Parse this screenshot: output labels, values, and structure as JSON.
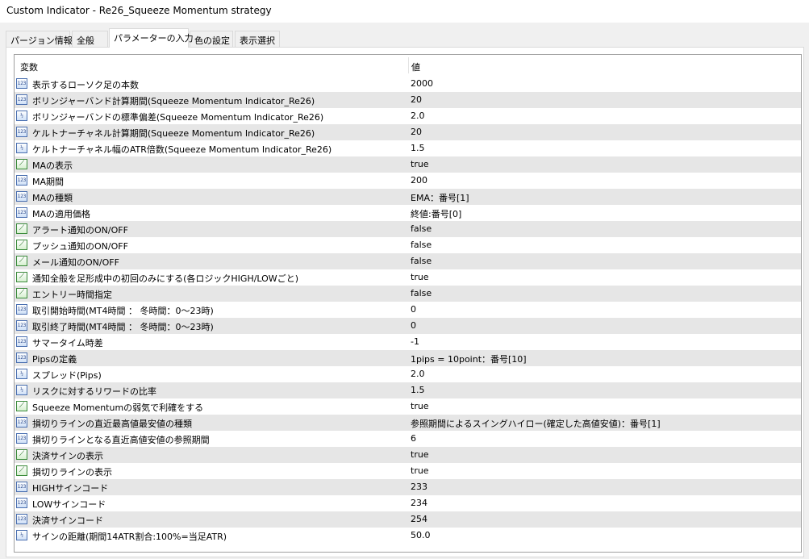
{
  "window": {
    "title": "Custom Indicator - Re26_Squeeze Momentum strategy"
  },
  "tabs": [
    {
      "label": "パージョン情報",
      "active": false
    },
    {
      "label": "全般",
      "active": false
    },
    {
      "label": "パラメーターの入力",
      "active": true
    },
    {
      "label": "色の設定",
      "active": false
    },
    {
      "label": "表示選択",
      "active": false
    }
  ],
  "table": {
    "headers": {
      "variable": "変数",
      "value": "値"
    },
    "rows": [
      {
        "icon": "int-icon",
        "icon_text": "123",
        "name": "表示するローソク足の本数",
        "value": "2000"
      },
      {
        "icon": "int-icon",
        "icon_text": "123",
        "name": "ボリンジャーバンド計算期間(Squeeze Momentum Indicator_Re26)",
        "value": "20"
      },
      {
        "icon": "double-icon",
        "icon_text": "½",
        "name": "ボリンジャーバンドの標準偏差(Squeeze Momentum Indicator_Re26)",
        "value": "2.0"
      },
      {
        "icon": "int-icon",
        "icon_text": "123",
        "name": "ケルトナーチャネル計算期間(Squeeze Momentum Indicator_Re26)",
        "value": "20"
      },
      {
        "icon": "double-icon",
        "icon_text": "½",
        "name": "ケルトナーチャネル幅のATR倍数(Squeeze Momentum Indicator_Re26)",
        "value": "1.5"
      },
      {
        "icon": "bool-icon",
        "icon_text": "⟋",
        "name": "MAの表示",
        "value": "true"
      },
      {
        "icon": "int-icon",
        "icon_text": "123",
        "name": "MA期間",
        "value": "200"
      },
      {
        "icon": "int-icon",
        "icon_text": "123",
        "name": "MAの種類",
        "value": "EMA：番号[1]"
      },
      {
        "icon": "int-icon",
        "icon_text": "123",
        "name": "MAの適用価格",
        "value": "終値:番号[0]"
      },
      {
        "icon": "bool-icon",
        "icon_text": "⟋",
        "name": "アラート通知のON/OFF",
        "value": "false"
      },
      {
        "icon": "bool-icon",
        "icon_text": "⟋",
        "name": "プッシュ通知のON/OFF",
        "value": "false"
      },
      {
        "icon": "bool-icon",
        "icon_text": "⟋",
        "name": "メール通知のON/OFF",
        "value": "false"
      },
      {
        "icon": "bool-icon",
        "icon_text": "⟋",
        "name": "通知全般を足形成中の初回のみにする(各ロジックHIGH/LOWごと)",
        "value": "true"
      },
      {
        "icon": "bool-icon",
        "icon_text": "⟋",
        "name": "エントリー時間指定",
        "value": "false"
      },
      {
        "icon": "int-icon",
        "icon_text": "123",
        "name": "取引開始時間(MT4時間 ： 冬時間：0～23時)",
        "value": "0"
      },
      {
        "icon": "int-icon",
        "icon_text": "123",
        "name": "取引終了時間(MT4時間 ： 冬時間：0～23時)",
        "value": "0"
      },
      {
        "icon": "int-icon",
        "icon_text": "123",
        "name": "サマータイム時差",
        "value": "-1"
      },
      {
        "icon": "int-icon",
        "icon_text": "123",
        "name": "Pipsの定義",
        "value": "1pips = 10point：番号[10]"
      },
      {
        "icon": "double-icon",
        "icon_text": "½",
        "name": "スプレッド(Pips)",
        "value": "2.0"
      },
      {
        "icon": "double-icon",
        "icon_text": "½",
        "name": "リスクに対するリワードの比率",
        "value": "1.5"
      },
      {
        "icon": "bool-icon",
        "icon_text": "⟋",
        "name": "Squeeze Momentumの弱気で利確をする",
        "value": "true"
      },
      {
        "icon": "int-icon",
        "icon_text": "123",
        "name": "損切りラインの直近最高値最安値の種類",
        "value": "参照期間によるスイングハイロー(確定した高値安値)：番号[1]"
      },
      {
        "icon": "int-icon",
        "icon_text": "123",
        "name": "損切りラインとなる直近高値安値の参照期間",
        "value": "6"
      },
      {
        "icon": "bool-icon",
        "icon_text": "⟋",
        "name": "決済サインの表示",
        "value": "true"
      },
      {
        "icon": "bool-icon",
        "icon_text": "⟋",
        "name": "損切りラインの表示",
        "value": "true"
      },
      {
        "icon": "int-icon",
        "icon_text": "123",
        "name": "HIGHサインコード",
        "value": "233"
      },
      {
        "icon": "int-icon",
        "icon_text": "123",
        "name": "LOWサインコード",
        "value": "234"
      },
      {
        "icon": "int-icon",
        "icon_text": "123",
        "name": "決済サインコード",
        "value": "254"
      },
      {
        "icon": "double-icon",
        "icon_text": "½",
        "name": "サインの距離(期間14ATR割合:100%=当足ATR)",
        "value": "50.0"
      }
    ]
  }
}
